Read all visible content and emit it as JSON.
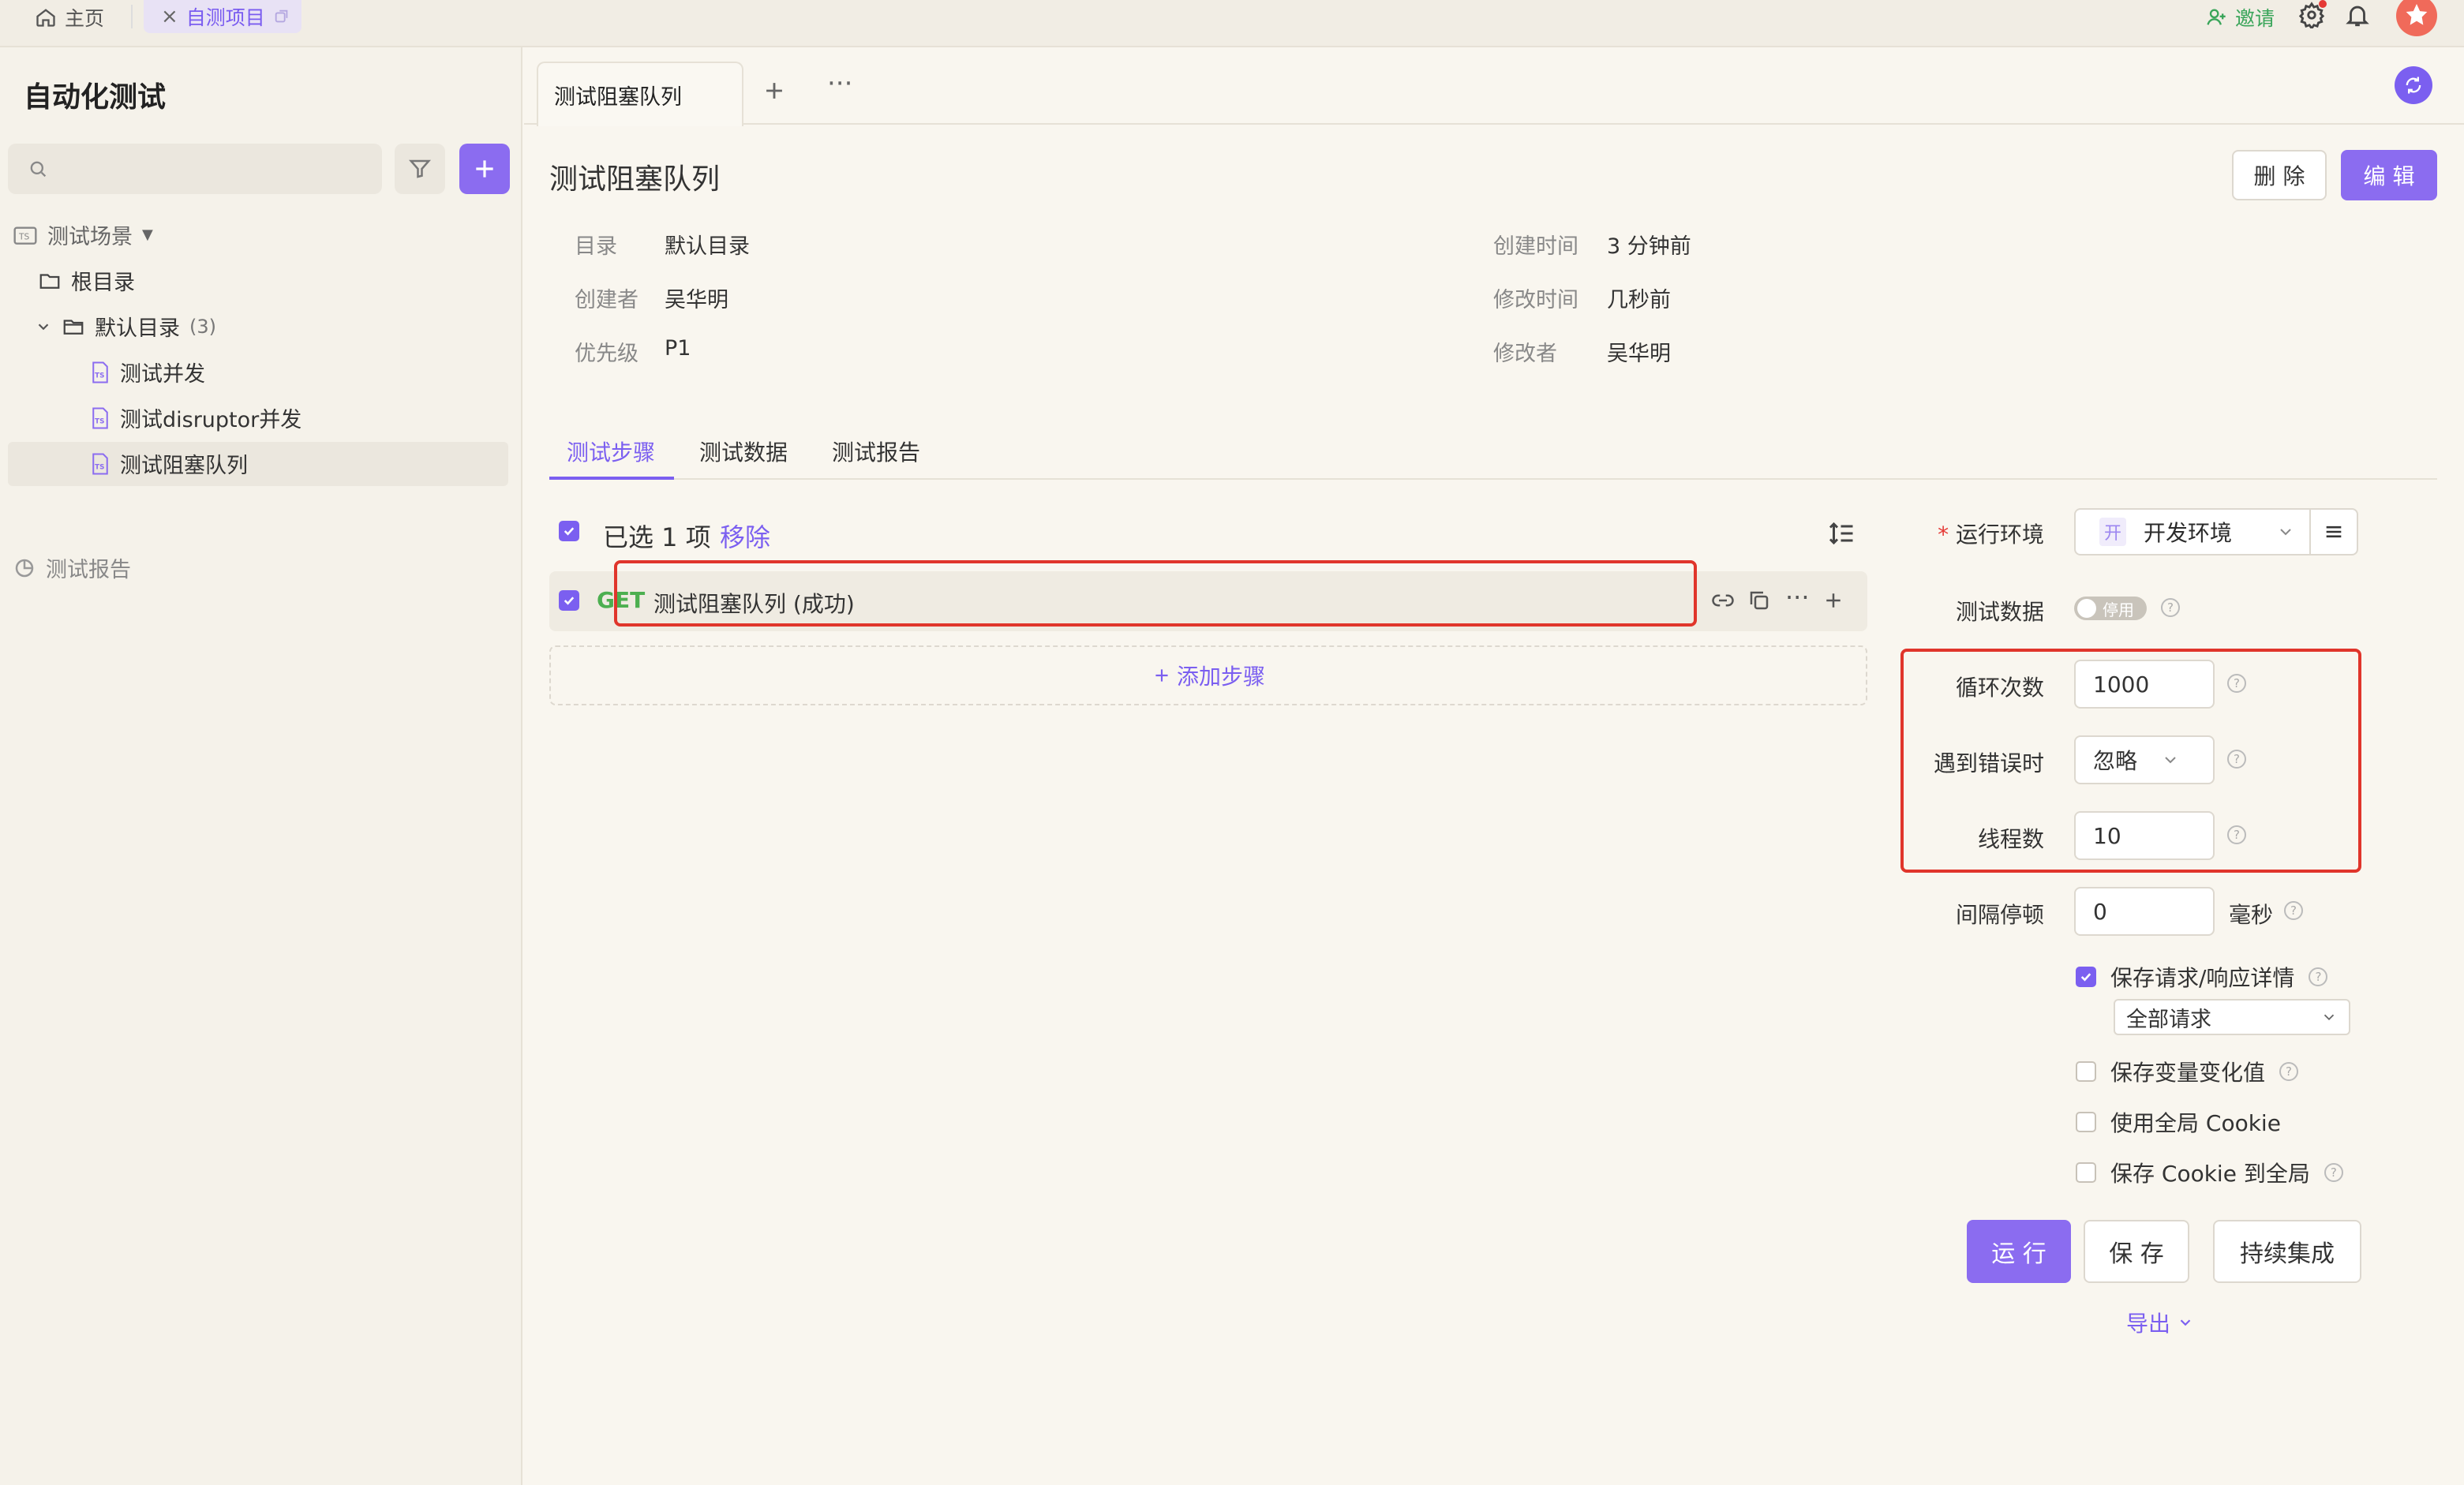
{
  "topbar": {
    "home_label": "主页",
    "project_tab_label": "自测项目",
    "invite_label": "邀请"
  },
  "sidebar": {
    "title": "自动化测试",
    "search_placeholder": "",
    "tree": {
      "scenes_label": "测试场景",
      "root_label": "根目录",
      "default_dir_label": "默认目录",
      "default_dir_count": "(3)",
      "items": [
        "测试并发",
        "测试disruptor并发",
        "测试阻塞队列"
      ],
      "ts_badge": "TS",
      "reports_label": "测试报告"
    }
  },
  "tabs": {
    "active_label": "测试阻塞队列"
  },
  "detail": {
    "title": "测试阻塞队列",
    "delete_label": "删 除",
    "edit_label": "编 辑",
    "meta_left": [
      {
        "label": "目录",
        "value": "默认目录"
      },
      {
        "label": "创建者",
        "value": "吴华明"
      },
      {
        "label": "优先级",
        "value": "P1"
      }
    ],
    "meta_right": [
      {
        "label": "创建时间",
        "value": "3 分钟前"
      },
      {
        "label": "修改时间",
        "value": "几秒前"
      },
      {
        "label": "修改者",
        "value": "吴华明"
      }
    ],
    "subtabs": [
      "测试步骤",
      "测试数据",
      "测试报告"
    ]
  },
  "steps": {
    "selected_text": "已选 1 项",
    "remove_label": "移除",
    "step": {
      "method": "GET",
      "name": "测试阻塞队列 (成功)"
    },
    "add_step_label": "添加步骤"
  },
  "settings": {
    "required_mark": "*",
    "env_label": "运行环境",
    "env_badge": "开",
    "env_value": "开发环境",
    "test_data_label": "测试数据",
    "test_data_toggle": "停用",
    "loop_label": "循环次数",
    "loop_value": "1000",
    "on_error_label": "遇到错误时",
    "on_error_value": "忽略",
    "threads_label": "线程数",
    "threads_value": "10",
    "interval_label": "间隔停顿",
    "interval_value": "0",
    "interval_unit": "毫秒",
    "save_detail_label": "保存请求/响应详情",
    "save_detail_scope": "全部请求",
    "save_vars_label": "保存变量变化值",
    "global_cookie_label": "使用全局 Cookie",
    "save_cookie_label": "保存 Cookie 到全局",
    "run_label": "运 行",
    "save_label": "保 存",
    "ci_label": "持续集成",
    "export_label": "导出"
  },
  "colors": {
    "accent": "#8b6cf0",
    "get_method": "#4caf50",
    "highlight_border": "#e0352b",
    "invite": "#3aa55a"
  }
}
